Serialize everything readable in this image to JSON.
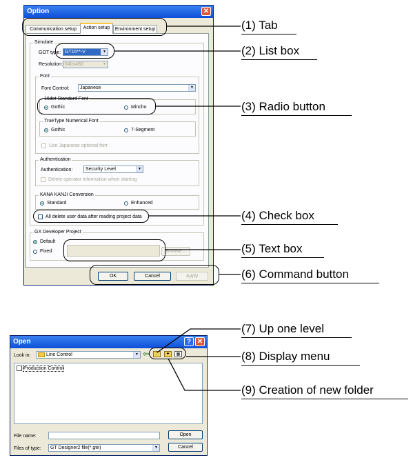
{
  "option_dialog": {
    "title": "Option",
    "tabs": [
      "Communication setup",
      "Action setup",
      "Environment setup"
    ],
    "simulate": {
      "caption": "Simulate",
      "got_type_label": "GOT type:",
      "got_type_value": "GT15**-V",
      "resolution_label": "Resolution:",
      "resolution_value": "640x480"
    },
    "font": {
      "caption": "Font",
      "font_control_label": "Font Control:",
      "font_control_value": "Japanese",
      "standard_font_caption": "16dot Standard Font",
      "gothic": "Gothic",
      "mincho": "Mincho",
      "truetype_caption": "TrueType Numerical Font",
      "gothic2": "Gothic",
      "seven_segment": "7-Segment",
      "use_japanese": "Use Japanese optional font"
    },
    "authentication": {
      "caption": "Authentication",
      "label": "Authentication:",
      "value": "Security Level",
      "delete_operator": "Delete operator information when starting"
    },
    "kana": {
      "caption": "KANA KANJI Conversion",
      "standard": "Standard",
      "enhanced": "Enhanced"
    },
    "all_delete": "All delete user data after reading project data",
    "gx": {
      "caption": "GX Developer Project",
      "default": "Default",
      "fixed": "Fixed",
      "browse": "Browse..."
    },
    "buttons": {
      "ok": "OK",
      "cancel": "Cancel",
      "apply": "Apply"
    }
  },
  "open_dialog": {
    "title": "Open",
    "help_glyph": "?",
    "close_glyph": "✕",
    "look_in_label": "Look in:",
    "look_in_value": "Line Control",
    "list_item": "Production Control",
    "file_name_label": "File name:",
    "file_name_value": "",
    "files_of_type_label": "Files of type:",
    "files_of_type_value": "GT Designer2 file(*.gte)",
    "open_button": "Open",
    "cancel_button": "Cancel"
  },
  "callouts": [
    "(1) Tab",
    "(2) List box",
    "(3) Radio button",
    "(4) Check box",
    "(5) Text box",
    "(6) Command button",
    "(7) Up one level",
    "(8) Display menu",
    "(9) Creation of new folder"
  ],
  "icons": {
    "folder": "folder-icon",
    "back": "back-arrow-icon",
    "up": "up-one-level-icon",
    "new_folder": "new-folder-icon",
    "menu": "display-menu-icon"
  }
}
